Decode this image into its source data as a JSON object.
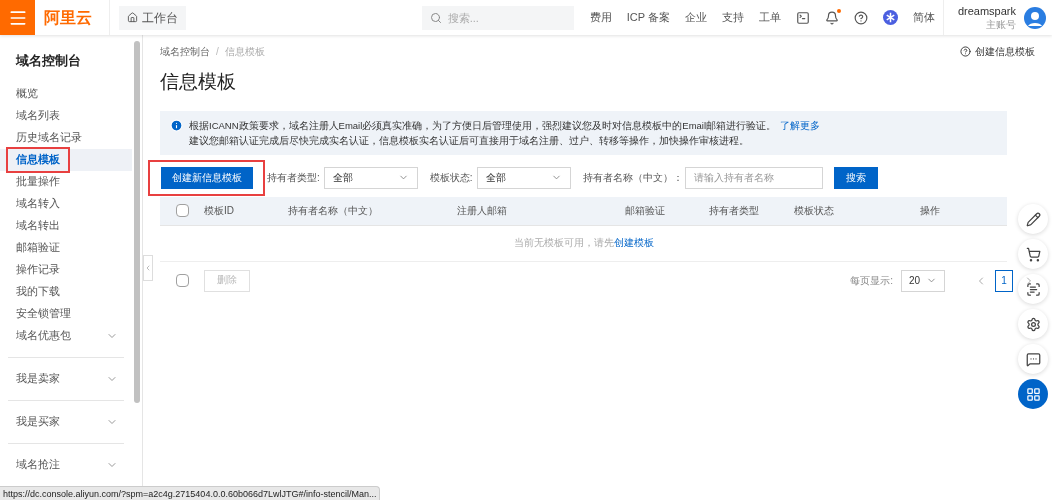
{
  "topbar": {
    "logo": "阿里云",
    "workbench": "工作台",
    "search": {
      "placeholder": "搜索..."
    },
    "links": [
      "费用",
      "ICP 备案",
      "企业",
      "支持",
      "工单"
    ],
    "notification_dot": true,
    "language": "简体",
    "user": {
      "name": "dreamspark",
      "role": "主账号"
    }
  },
  "sidebar": {
    "title": "域名控制台",
    "items": [
      {
        "kind": "link",
        "label": "概览",
        "selected": false,
        "highlighted": false
      },
      {
        "kind": "link",
        "label": "域名列表",
        "selected": false,
        "highlighted": false
      },
      {
        "kind": "link",
        "label": "历史域名记录",
        "selected": false,
        "highlighted": false
      },
      {
        "kind": "link",
        "label": "信息模板",
        "selected": true,
        "highlighted": true
      },
      {
        "kind": "link",
        "label": "批量操作",
        "selected": false,
        "highlighted": false
      },
      {
        "kind": "link",
        "label": "域名转入",
        "selected": false,
        "highlighted": false
      },
      {
        "kind": "link",
        "label": "域名转出",
        "selected": false,
        "highlighted": false
      },
      {
        "kind": "link",
        "label": "邮箱验证",
        "selected": false,
        "highlighted": false
      },
      {
        "kind": "link",
        "label": "操作记录",
        "selected": false,
        "highlighted": false
      },
      {
        "kind": "link",
        "label": "我的下载",
        "selected": false,
        "highlighted": false
      },
      {
        "kind": "link",
        "label": "安全锁管理",
        "selected": false,
        "highlighted": false
      },
      {
        "kind": "group",
        "label": "域名优惠包",
        "expanded": false
      },
      {
        "kind": "section",
        "label": "我是卖家",
        "expanded": false
      },
      {
        "kind": "section",
        "label": "我是买家",
        "expanded": false
      },
      {
        "kind": "section",
        "label": "域名抢注",
        "expanded": false
      }
    ]
  },
  "breadcrumb": [
    "域名控制台",
    "信息模板"
  ],
  "breadcrumb_separator": "/",
  "help_link": "创建信息模板",
  "page_title": "信息模板",
  "notice": {
    "text": "根据ICANN政策要求，域名注册人Email必须真实准确，为了方便日后管理使用，强烈建议您及时对信息模板中的Email邮箱进行验证。",
    "link": "了解更多",
    "line2": "建议您邮箱认证完成后尽快完成实名认证，信息模板实名认证后可直接用于域名注册、过户、转移等操作，加快操作审核进程。"
  },
  "toolbar": {
    "create_button": {
      "label": "创建新信息模板",
      "highlighted": true
    },
    "filters": [
      {
        "label": "持有者类型:",
        "value": "全部"
      },
      {
        "label": "模板状态:",
        "value": "全部"
      }
    ],
    "name_filter": {
      "label": "持有者名称（中文）：",
      "placeholder": "请输入持有者名称"
    },
    "search_button": "搜索"
  },
  "table": {
    "header_checked": false,
    "columns": [
      "模板ID",
      "持有者名称（中文）",
      "注册人邮箱",
      "邮箱验证",
      "持有者类型",
      "模板状态",
      "操作"
    ],
    "empty_text": "当前无模板可用，请先",
    "empty_link": "创建模板"
  },
  "footer": {
    "checked": false,
    "delete_button": {
      "label": "删除",
      "disabled": true
    },
    "page_size_label": "每页显示:",
    "page_size": "20",
    "pages": [
      {
        "label": "1",
        "selected": true
      }
    ]
  },
  "status_url": "https://dc.console.aliyun.com/?spm=a2c4g.2715404.0.0.60b066d7LwlJTG#/info-stencil/Man..."
}
